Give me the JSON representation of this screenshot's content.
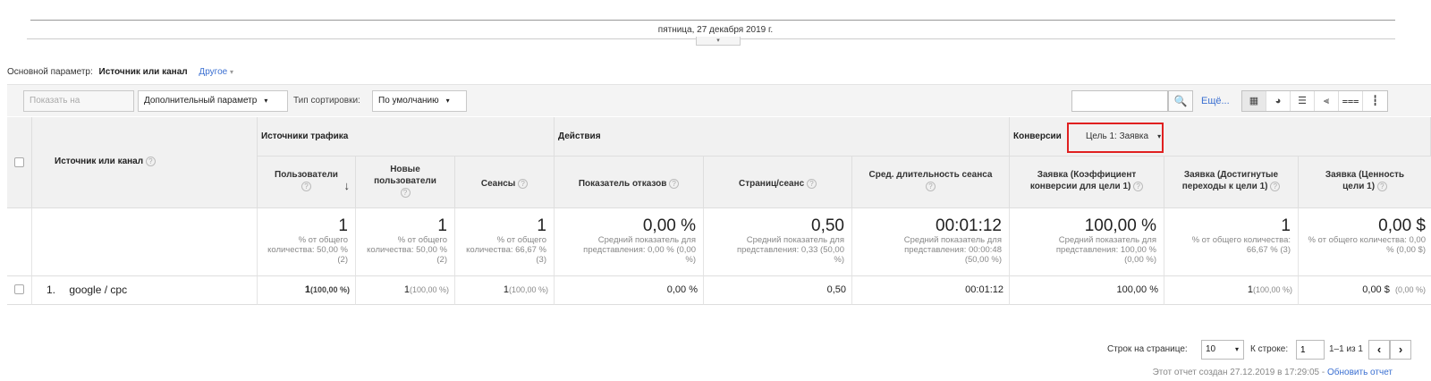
{
  "timeline": {
    "date": "пятница, 27 декабря 2019 г.",
    "toggle": "▾"
  },
  "primary": {
    "label": "Основной параметр:",
    "selected": "Источник или канал",
    "other": "Другое",
    "other_caret": "▾"
  },
  "toolbar": {
    "plot_button": "Показать на диаграмме",
    "secondary_dim": "Дополнительный параметр",
    "caret": "▾",
    "sort_label": "Тип сортировки:",
    "sort_value": "По умолчанию",
    "search_placeholder": "",
    "search_icon": "🔍",
    "more": "Ещё...",
    "views": [
      "▦",
      "◕",
      "☰",
      "⫷",
      "⩶",
      "┇"
    ]
  },
  "table": {
    "dim_header": "Источник или канал",
    "groups": {
      "traffic": "Источники трафика",
      "actions": "Действия",
      "conversions": "Конверсии",
      "goal_select": "Цель 1: Заявка"
    },
    "question": "?",
    "sort_arrow": "↓",
    "columns": {
      "users": "Пользователи",
      "new_users": "Новые пользователи",
      "sessions": "Сеансы",
      "bounce": "Показатель отказов",
      "pages": "Страниц/сеанс",
      "duration": "Сред. длительность сеанса",
      "conv_rate": "Заявка (Коэффициент конверсии для цели 1)",
      "completions": "Заявка (Достигнутые переходы к цели 1)",
      "value": "Заявка (Ценность цели 1)"
    },
    "totals": {
      "users": {
        "big": "1",
        "sub": "% от общего количества: 50,00 % (2)"
      },
      "new_users": {
        "big": "1",
        "sub": "% от общего количества: 50,00 % (2)"
      },
      "sessions": {
        "big": "1",
        "sub": "% от общего количества: 66,67 % (3)"
      },
      "bounce": {
        "big": "0,00 %",
        "sub": "Средний показатель для представления: 0,00 % (0,00 %)"
      },
      "pages": {
        "big": "0,50",
        "sub": "Средний показатель для представления: 0,33 (50,00 %)"
      },
      "duration": {
        "big": "00:01:12",
        "sub": "Средний показатель для представления: 00:00:48 (50,00 %)"
      },
      "conv_rate": {
        "big": "100,00 %",
        "sub": "Средний показатель для представления: 100,00 % (0,00 %)"
      },
      "completions": {
        "big": "1",
        "sub": "% от общего количества: 66,67 % (3)"
      },
      "value": {
        "big": "0,00 $",
        "sub": "% от общего количества: 0,00 % (0,00 $)"
      }
    },
    "rows": [
      {
        "index": "1.",
        "source": "google / cpc",
        "users": "1",
        "users_pct": "(100,00 %)",
        "new_users": "1",
        "new_users_pct": "(100,00 %)",
        "sessions": "1",
        "sessions_pct": "(100,00 %)",
        "bounce": "0,00 %",
        "pages": "0,50",
        "duration": "00:01:12",
        "conv_rate": "100,00 %",
        "completions": "1",
        "completions_pct": "(100,00 %)",
        "value": "0,00 $",
        "value_pct": "(0,00 %)"
      }
    ]
  },
  "pagination": {
    "rows_label": "Строк на странице:",
    "rows_value": "10",
    "goto_label": "К строке:",
    "goto_value": "1",
    "range": "1–1 из 1",
    "prev": "‹",
    "next": "›"
  },
  "created": {
    "text": "Этот отчет создан 27.12.2019 в 17:29:05 - ",
    "link": "Обновить отчет"
  }
}
